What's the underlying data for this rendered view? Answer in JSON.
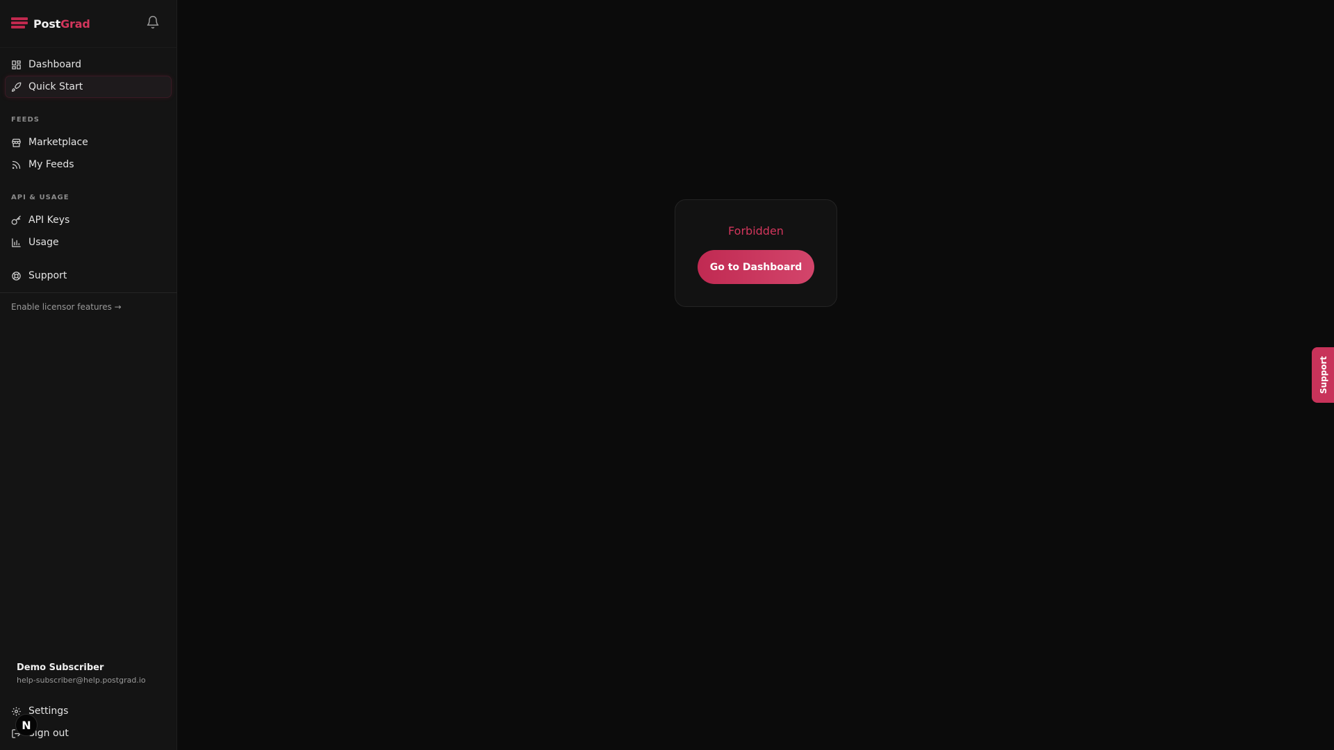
{
  "brand": {
    "name_part1": "Post",
    "name_part2": "Grad",
    "accent_color": "#d2365c"
  },
  "nav": {
    "dashboard": "Dashboard",
    "quick_start": "Quick Start",
    "feeds_label": "FEEDS",
    "marketplace": "Marketplace",
    "my_feeds": "My Feeds",
    "api_label": "API & USAGE",
    "api_keys": "API Keys",
    "usage": "Usage",
    "support": "Support",
    "licensor": "Enable licensor features →"
  },
  "user": {
    "name": "Demo Subscriber",
    "email": "help-subscriber@help.postgrad.io",
    "avatar_letter": "N"
  },
  "footer_nav": {
    "settings": "Settings",
    "sign_out": "Sign out"
  },
  "main": {
    "error_title": "Forbidden",
    "button_label": "Go to Dashboard"
  },
  "support_tab": {
    "label": "Support"
  },
  "icons": [
    "postgrad-logo-icon",
    "bell-icon",
    "dashboard-icon",
    "rocket-icon",
    "store-icon",
    "rss-icon",
    "key-icon",
    "bar-chart-icon",
    "lifebuoy-icon",
    "gear-icon",
    "sign-out-icon"
  ]
}
